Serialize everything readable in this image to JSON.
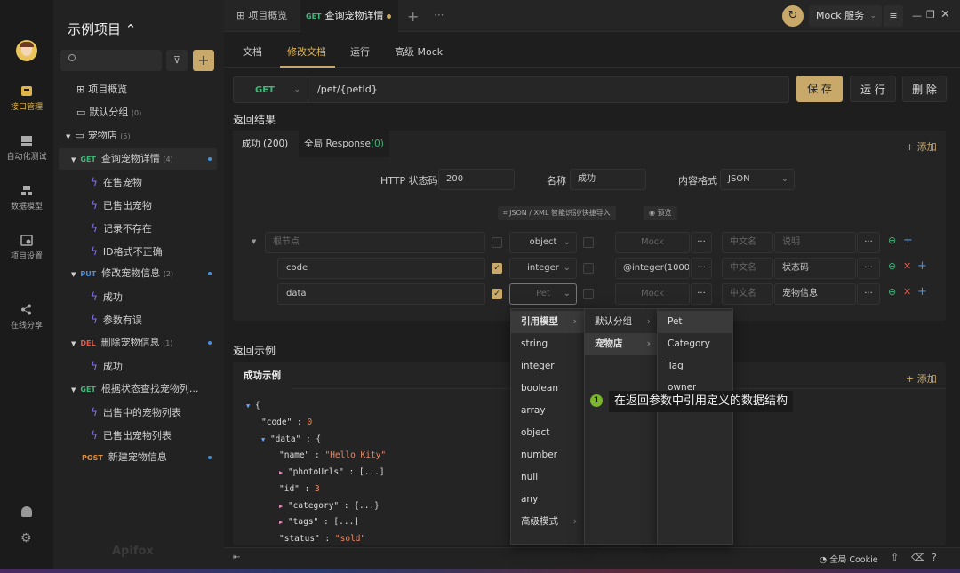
{
  "colors": {
    "accent": "#c8a96a",
    "get": "#3fb878",
    "put": "#4a8fe0",
    "del": "#e05a4a",
    "post": "#e08c3a"
  },
  "rail": {
    "items": [
      {
        "label": "接口管理",
        "icon": "api-icon"
      },
      {
        "label": "自动化测试",
        "icon": "stack-icon"
      },
      {
        "label": "数据模型",
        "icon": "model-icon"
      },
      {
        "label": "项目设置",
        "icon": "settings-icon"
      },
      {
        "label": "在线分享",
        "icon": "share-icon"
      }
    ]
  },
  "project": {
    "title": "示例项目 ⌃"
  },
  "tree": [
    {
      "label": "项目概览"
    },
    {
      "label": "默认分组",
      "count": "(0)"
    },
    {
      "label": "宠物店",
      "count": "(5)"
    },
    {
      "method": "GET",
      "label": "查询宠物详情",
      "count": "(4)"
    },
    {
      "label": "在售宠物"
    },
    {
      "label": "已售出宠物"
    },
    {
      "label": "记录不存在"
    },
    {
      "label": "ID格式不正确"
    },
    {
      "method": "PUT",
      "label": "修改宠物信息",
      "count": "(2)"
    },
    {
      "label": "成功"
    },
    {
      "label": "参数有误"
    },
    {
      "method": "DEL",
      "label": "删除宠物信息",
      "count": "(1)"
    },
    {
      "label": "成功"
    },
    {
      "method": "GET",
      "label": "根据状态查找宠物列..."
    },
    {
      "label": "出售中的宠物列表"
    },
    {
      "label": "已售出宠物列表"
    },
    {
      "method": "POST",
      "label": "新建宠物信息"
    }
  ],
  "brand": "Apifox",
  "tabs": {
    "overview": "项目概览",
    "active_method": "GET",
    "active": "查询宠物详情",
    "mock": "Mock 服务"
  },
  "subtabs": [
    "文档",
    "修改文档",
    "运行",
    "高级 Mock"
  ],
  "request": {
    "method": "GET",
    "path": "/pet/{petId}",
    "save": "保 存",
    "run": "运 行",
    "delete": "删 除"
  },
  "response": {
    "title": "返回结果",
    "tab_success": "成功 (200)",
    "tab_global": "全局 Response",
    "tab_global_count": "(0)",
    "add": "+ 添加",
    "status_label": "HTTP 状态码:",
    "status": "200",
    "name_label": "名称",
    "name": "成功",
    "format_label": "内容格式",
    "format": "JSON",
    "import": "JSON / XML 智能识别/快捷导入",
    "preview": "预览",
    "rows": [
      {
        "name": "根节点",
        "type": "object",
        "mock": "Mock",
        "cn": "中文名",
        "desc": "说明"
      },
      {
        "name": "code",
        "type": "integer",
        "mock": "@integer(1000",
        "cn": "中文名",
        "desc": "状态码"
      },
      {
        "name": "data",
        "type": "Pet",
        "mock": "Mock",
        "cn": "中文名",
        "desc": "宠物信息"
      }
    ]
  },
  "example": {
    "title": "返回示例",
    "tab": "成功示例",
    "add": "+ 添加",
    "lines": [
      "{",
      "\"code\" : 0",
      "\"data\" : {",
      "\"name\" : \"Hello Kity\"",
      "\"photoUrls\" : [...]",
      "\"id\" : 3",
      "\"category\" : {...}",
      "\"tags\" : [...]",
      "\"status\" : \"sold\""
    ]
  },
  "menu1": [
    "引用模型",
    "string",
    "integer",
    "boolean",
    "array",
    "object",
    "number",
    "null",
    "any",
    "高级模式"
  ],
  "menu2": [
    "默认分组",
    "宠物店"
  ],
  "menu3": [
    "Pet",
    "Category",
    "Tag",
    "owner"
  ],
  "tooltip": {
    "num": "1",
    "text": "在返回参数中引用定义的数据结构"
  },
  "footer": {
    "cookie": "全局 Cookie"
  }
}
